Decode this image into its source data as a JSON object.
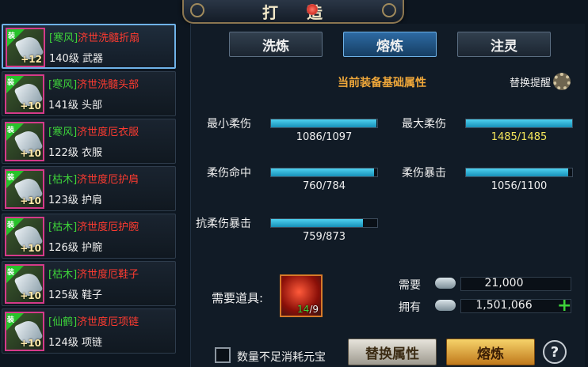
{
  "title": {
    "chars": [
      "打",
      "造"
    ]
  },
  "items": [
    {
      "tag": "[寒风]",
      "name": "济世洗髓折扇",
      "level": "140级",
      "slot": "武器",
      "plus": "+12",
      "badge": "装",
      "selected": true
    },
    {
      "tag": "[寒风]",
      "name": "济世洗髓头部",
      "level": "141级",
      "slot": "头部",
      "plus": "+10",
      "badge": "装",
      "selected": false
    },
    {
      "tag": "[寒风]",
      "name": "济世度厄衣服",
      "level": "122级",
      "slot": "衣服",
      "plus": "+10",
      "badge": "装",
      "selected": false
    },
    {
      "tag": "[枯木]",
      "name": "济世度厄护肩",
      "level": "123级",
      "slot": "护肩",
      "plus": "+10",
      "badge": "装",
      "selected": false
    },
    {
      "tag": "[枯木]",
      "name": "济世度厄护腕",
      "level": "126级",
      "slot": "护腕",
      "plus": "+10",
      "badge": "装",
      "selected": false
    },
    {
      "tag": "[枯木]",
      "name": "济世度厄鞋子",
      "level": "125级",
      "slot": "鞋子",
      "plus": "+10",
      "badge": "装",
      "selected": false
    },
    {
      "tag": "[仙鹤]",
      "name": "济世度厄项链",
      "level": "124级",
      "slot": "项链",
      "plus": "+10",
      "badge": "装",
      "selected": false
    }
  ],
  "tabs": [
    {
      "label": "洗炼",
      "active": false
    },
    {
      "label": "熔炼",
      "active": true
    },
    {
      "label": "注灵",
      "active": false
    }
  ],
  "section_title": "当前装备基础属性",
  "swap_hint": "替换提醒",
  "stats": [
    {
      "label": "最小柔伤",
      "current": 1086,
      "max": 1097,
      "text": "1086/1097"
    },
    {
      "label": "最大柔伤",
      "current": 1485,
      "max": 1485,
      "text": "1485/1485"
    },
    {
      "label": "柔伤命中",
      "current": 760,
      "max": 784,
      "text": "760/784"
    },
    {
      "label": "柔伤暴击",
      "current": 1056,
      "max": 1100,
      "text": "1056/1100"
    },
    {
      "label": "抗柔伤暴击",
      "current": 759,
      "max": 873,
      "text": "759/873"
    }
  ],
  "need": {
    "label": "需要道具:",
    "have": "14",
    "need": "/9"
  },
  "cost": {
    "need_label": "需要",
    "need_value": "21,000",
    "own_label": "拥有",
    "own_value": "1,501,066"
  },
  "footer": {
    "checkbox_label": "数量不足消耗元宝",
    "swap_button": "替换属性",
    "smelt_button": "熔炼",
    "help": "?"
  },
  "colors": {
    "accent": "#6fb2e8",
    "bar": "#2bb3de",
    "tag": "#3ed43a",
    "name": "#ff3b30",
    "title": "#f0a83a"
  }
}
